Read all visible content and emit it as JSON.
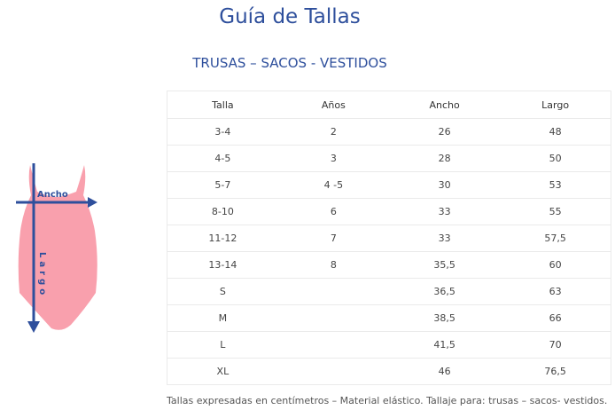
{
  "header": {
    "title": "Guía de Tallas",
    "subtitle": "TRUSAS – SACOS - VESTIDOS"
  },
  "figure": {
    "width_label": "Ancho",
    "length_label": "Largo",
    "garment_color": "#f9a0ad",
    "arrow_color": "#2e4f9c"
  },
  "table": {
    "headers": [
      "Talla",
      "Años",
      "Ancho",
      "Largo"
    ],
    "rows": [
      [
        "3-4",
        "2",
        "26",
        "48"
      ],
      [
        "4-5",
        "3",
        "28",
        "50"
      ],
      [
        "5-7",
        "4 -5",
        "30",
        "53"
      ],
      [
        "8-10",
        "6",
        "33",
        "55"
      ],
      [
        "11-12",
        "7",
        "33",
        "57,5"
      ],
      [
        "13-14",
        "8",
        "35,5",
        "60"
      ],
      [
        "S",
        "",
        "36,5",
        "63"
      ],
      [
        "M",
        "",
        "38,5",
        "66"
      ],
      [
        "L",
        "",
        "41,5",
        "70"
      ],
      [
        "XL",
        "",
        "46",
        "76,5"
      ]
    ]
  },
  "footer": {
    "note": "Tallas expresadas en centímetros – Material elástico. Tallaje para: trusas – sacos- vestidos."
  }
}
